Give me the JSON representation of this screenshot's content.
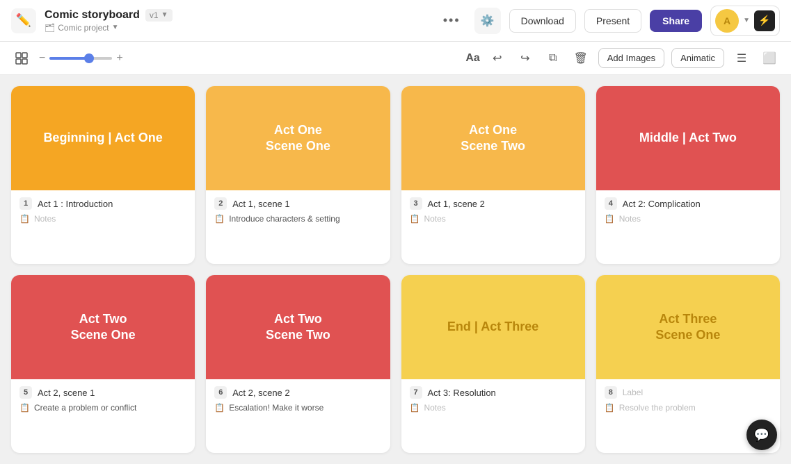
{
  "header": {
    "title": "Comic storyboard",
    "version": "v1",
    "project": "Comic project",
    "download_label": "Download",
    "present_label": "Present",
    "share_label": "Share",
    "avatar_initials": "A"
  },
  "toolbar": {
    "minus": "−",
    "plus": "+",
    "aa_label": "Aa",
    "add_images_label": "Add Images",
    "animatic_label": "Animatic"
  },
  "cards": [
    {
      "id": 1,
      "color": "orange",
      "image_text": "Beginning | Act One",
      "number": "1",
      "title": "Act 1 : Introduction",
      "notes": "Notes"
    },
    {
      "id": 2,
      "color": "orange-light",
      "image_text": "Act One\nScene One",
      "number": "2",
      "title": "Act 1, scene 1",
      "notes": "Introduce characters & setting"
    },
    {
      "id": 3,
      "color": "orange-light",
      "image_text": "Act One\nScene Two",
      "number": "3",
      "title": "Act 1, scene 2",
      "notes": "Notes"
    },
    {
      "id": 4,
      "color": "red",
      "image_text": "Middle | Act Two",
      "number": "4",
      "title": "Act 2: Complication",
      "notes": "Notes"
    },
    {
      "id": 5,
      "color": "red",
      "image_text": "Act Two\nScene One",
      "number": "5",
      "title": "Act 2, scene 1",
      "notes": "Create a problem or conflict"
    },
    {
      "id": 6,
      "color": "red",
      "image_text": "Act Two\nScene Two",
      "number": "6",
      "title": "Act 2, scene 2",
      "notes": "Escalation! Make it worse"
    },
    {
      "id": 7,
      "color": "yellow",
      "image_text": "End | Act Three",
      "number": "7",
      "title": "Act 3: Resolution",
      "notes": "Notes"
    },
    {
      "id": 8,
      "color": "yellow",
      "image_text": "Act Three\nScene One",
      "number": "8",
      "title": "Label",
      "notes": "Resolve the problem"
    }
  ]
}
